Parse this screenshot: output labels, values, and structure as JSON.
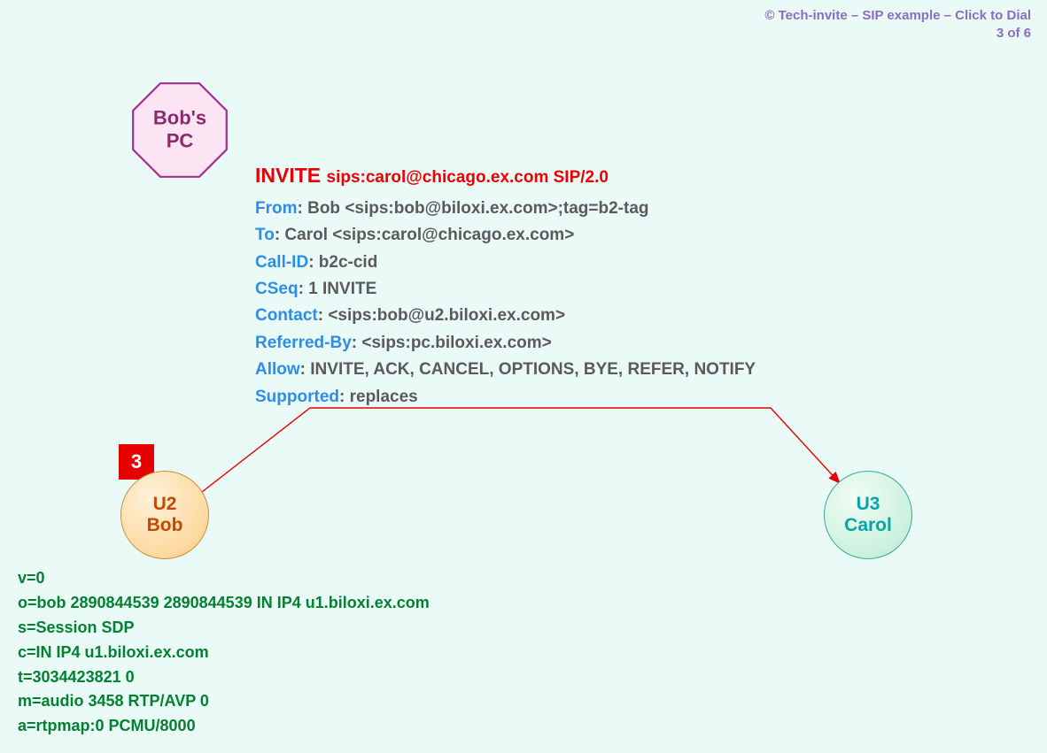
{
  "copyright": {
    "line1": "© Tech-invite – SIP example – Click to Dial",
    "line2": "3 of 6"
  },
  "octagon": {
    "line1": "Bob's",
    "line2": "PC"
  },
  "sip": {
    "method": "INVITE",
    "request_uri": "sips:carol@chicago.ex.com SIP/2.0",
    "headers": [
      {
        "key": "From",
        "value": ": Bob <sips:bob@biloxi.ex.com>;tag=b2-tag"
      },
      {
        "key": "To",
        "value": ": Carol <sips:carol@chicago.ex.com>"
      },
      {
        "key": "Call-ID",
        "value": ": b2c-cid"
      },
      {
        "key": "CSeq",
        "value": ": 1 INVITE"
      },
      {
        "key": "Contact",
        "value": ": <sips:bob@u2.biloxi.ex.com>"
      },
      {
        "key": "Referred-By",
        "value": ": <sips:pc.biloxi.ex.com>"
      },
      {
        "key": "Allow",
        "value": ": INVITE, ACK, CANCEL, OPTIONS, BYE, REFER, NOTIFY"
      },
      {
        "key": "Supported",
        "value": ": replaces"
      }
    ]
  },
  "step_number": "3",
  "nodes": {
    "bob": {
      "id": "U2",
      "name": "Bob"
    },
    "carol": {
      "id": "U3",
      "name": "Carol"
    }
  },
  "sdp": [
    "v=0",
    "o=bob  2890844539  2890844539  IN  IP4  u1.biloxi.ex.com",
    "s=Session SDP",
    "c=IN  IP4  u1.biloxi.ex.com",
    "t=3034423821  0",
    "m=audio  3458  RTP/AVP  0",
    "a=rtpmap:0  PCMU/8000"
  ]
}
